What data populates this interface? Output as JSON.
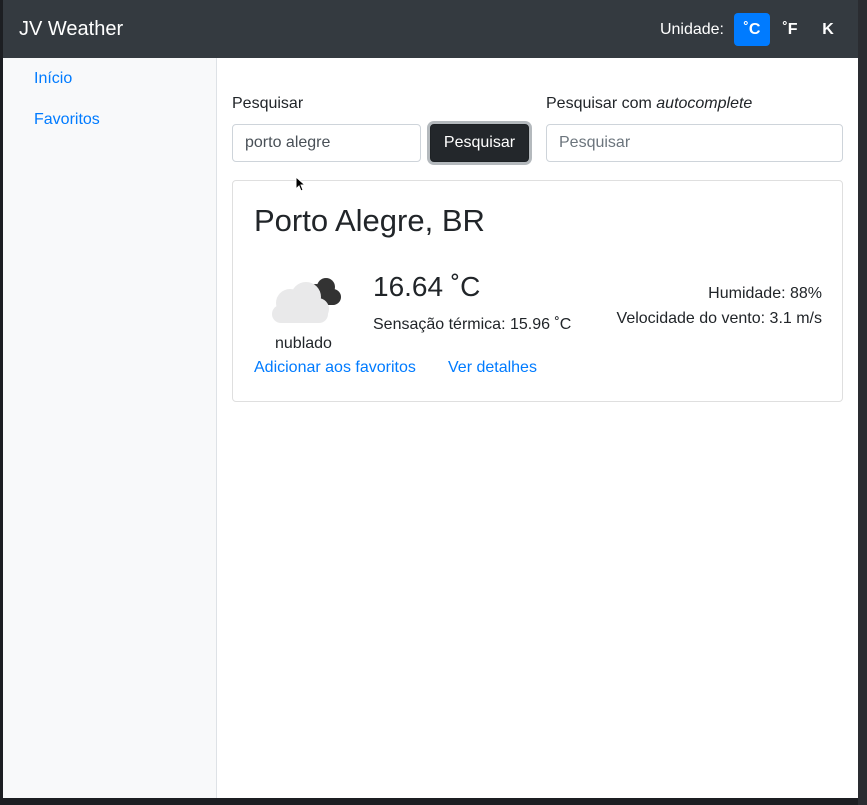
{
  "app": {
    "brand": "JV Weather"
  },
  "units": {
    "label": "Unidade:",
    "options": [
      "˚C",
      "˚F",
      "K"
    ],
    "selected": "˚C"
  },
  "sidebar": {
    "items": [
      {
        "label": "Início"
      },
      {
        "label": "Favoritos"
      }
    ]
  },
  "search": {
    "label": "Pesquisar",
    "value": "porto alegre",
    "button_label": "Pesquisar"
  },
  "autocomplete": {
    "label_prefix": "Pesquisar com ",
    "label_emphasis": "autocomplete",
    "placeholder": "Pesquisar"
  },
  "result": {
    "city": "Porto Alegre, BR",
    "icon": "cloudy-icon",
    "condition": "nublado",
    "temperature": "16.64 ˚C",
    "feels_like": "Sensação térmica: 15.96 ˚C",
    "humidity": "Humidade: 88%",
    "wind": "Velocidade do vento: 3.1 m/s",
    "add_favorite": "Adicionar aos favoritos",
    "details": "Ver detalhes"
  },
  "colors": {
    "navbar": "#343a40",
    "accent": "#007bff",
    "sidebar": "#f8f9fa"
  }
}
